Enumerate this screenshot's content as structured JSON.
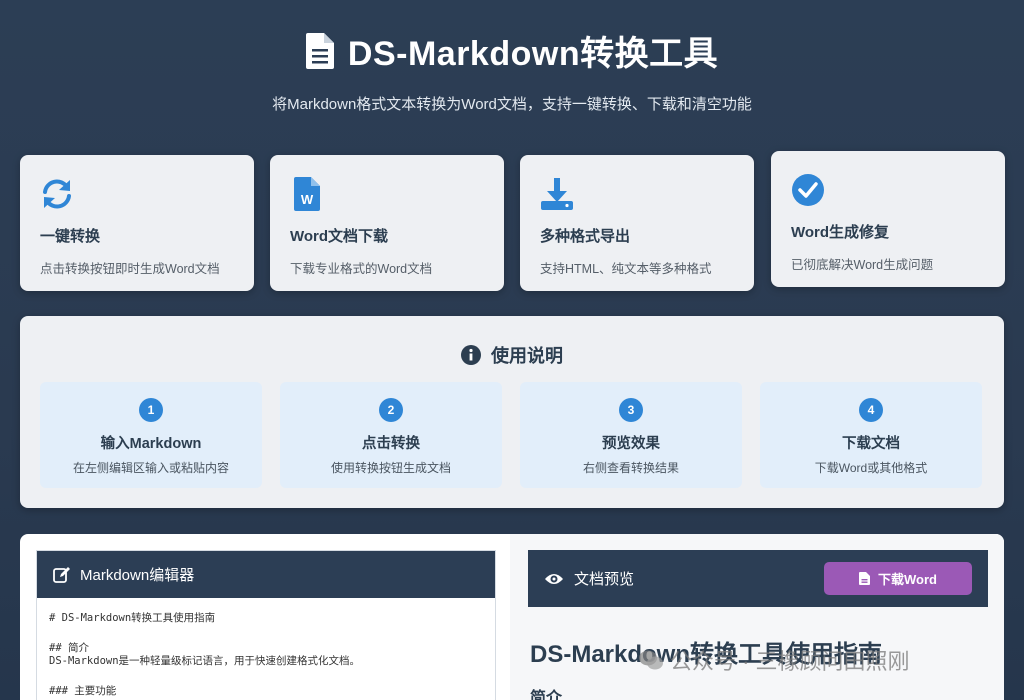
{
  "header": {
    "title": "DS-Markdown转换工具",
    "subtitle": "将Markdown格式文本转换为Word文档，支持一键转换、下载和清空功能"
  },
  "features": [
    {
      "icon": "sync-icon",
      "title": "一键转换",
      "desc": "点击转换按钮即时生成Word文档"
    },
    {
      "icon": "word-file-icon",
      "title": "Word文档下载",
      "desc": "下载专业格式的Word文档"
    },
    {
      "icon": "download-icon",
      "title": "多种格式导出",
      "desc": "支持HTML、纯文本等多种格式"
    },
    {
      "icon": "check-circle-icon",
      "title": "Word生成修复",
      "desc": "已彻底解决Word生成问题"
    }
  ],
  "instructions": {
    "title": "使用说明",
    "steps": [
      {
        "num": "1",
        "title": "输入Markdown",
        "desc": "在左侧编辑区输入或粘贴内容"
      },
      {
        "num": "2",
        "title": "点击转换",
        "desc": "使用转换按钮生成文档"
      },
      {
        "num": "3",
        "title": "预览效果",
        "desc": "右侧查看转换结果"
      },
      {
        "num": "4",
        "title": "下载文档",
        "desc": "下载Word或其他格式"
      }
    ]
  },
  "editor": {
    "title": "Markdown编辑器",
    "lines": [
      "# DS-Markdown转换工具使用指南",
      "",
      "## 简介",
      "DS-Markdown是一种轻量级标记语言，用于快速创建格式化文档。",
      "",
      "### 主要功能"
    ]
  },
  "preview": {
    "title": "文档预览",
    "download_label": "下载Word",
    "doc_title": "DS-Markdown转换工具使用指南",
    "doc_subheading": "简介"
  },
  "watermark": {
    "text": "公众号 · 三橡顾问田照刚"
  },
  "colors": {
    "background": "#2c3e55",
    "accent_blue": "#2f86d6",
    "download_button": "#9b59b6"
  }
}
